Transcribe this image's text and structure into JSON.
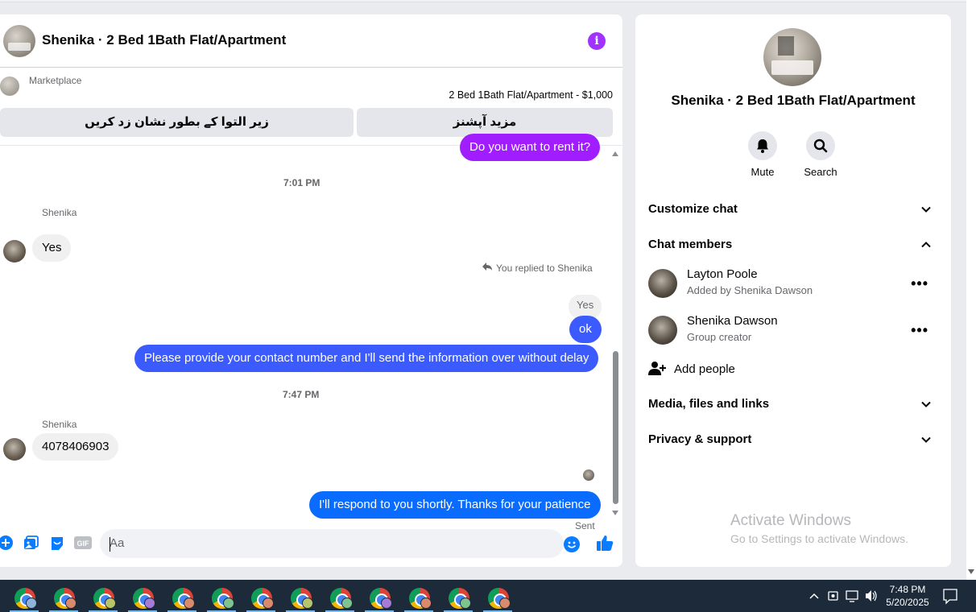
{
  "chat": {
    "title": "Shenika · 2 Bed 1Bath Flat/Apartment",
    "info_icon": "info-icon",
    "marketplace": {
      "label": "Marketplace",
      "listing": "2 Bed 1Bath Flat/Apartment - $1,000",
      "btn_mark_pending": "زیر التوا کے بطور نشان زد کریں",
      "btn_more_options": "مزید آپشنز"
    },
    "messages": {
      "first_partial": "Do you want to rent it?",
      "time1": "7:01 PM",
      "sender1": "Shenika",
      "msg_yes": "Yes",
      "replied_label": "You replied to Shenika",
      "quoted": "Yes",
      "msg_ok": "ok",
      "msg_provide": "Please provide your contact number and I'll send the information over without delay",
      "time2": "7:47 PM",
      "sender2": "Shenika",
      "msg_number": "4078406903",
      "msg_respond": "I'll respond to you shortly. Thanks for your patience",
      "status": "Sent"
    },
    "composer": {
      "placeholder": "Aa"
    },
    "colors": {
      "purple": "#a11cff",
      "indigo": "#3b5bff",
      "blue": "#0a6cff"
    }
  },
  "side": {
    "title": "Shenika · 2 Bed 1Bath Flat/Apartment",
    "actions": {
      "mute": "Mute",
      "search": "Search"
    },
    "sections": {
      "customize": "Customize chat",
      "members": "Chat members",
      "media": "Media, files and links",
      "privacy": "Privacy & support"
    },
    "members": [
      {
        "name": "Layton Poole",
        "sub": "Added by Shenika Dawson"
      },
      {
        "name": "Shenika Dawson",
        "sub": "Group creator"
      }
    ],
    "add_people": "Add people",
    "watermark": {
      "line1": "Activate Windows",
      "line2": "Go to Settings to activate Windows."
    }
  },
  "taskbar": {
    "time": "7:48 PM",
    "date": "5/20/2025",
    "app_count": 13
  }
}
